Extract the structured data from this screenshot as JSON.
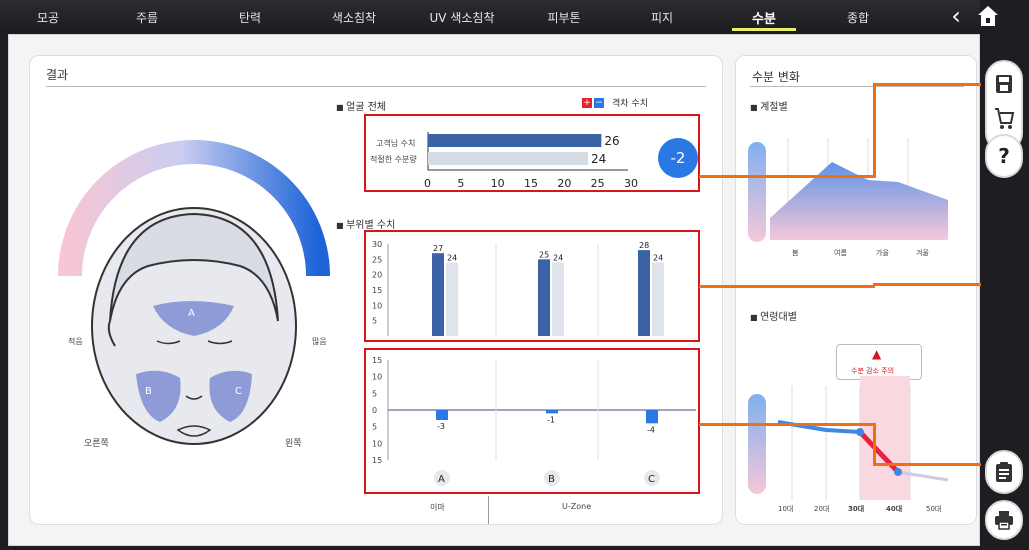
{
  "nav": {
    "tabs": [
      "모공",
      "주름",
      "탄력",
      "색소침착",
      "UV 색소침착",
      "피부톤",
      "피지",
      "수분",
      "종합"
    ],
    "active": "수분"
  },
  "result": {
    "title": "결과",
    "left_label": "적음",
    "right_label": "많음",
    "zone_a": "A",
    "zone_b": "B",
    "zone_c": "C",
    "side_right": "오른쪽",
    "side_left": "왼쪽"
  },
  "whole_face": {
    "title": "얼굴 전체",
    "legend": "격차 수치",
    "customer_label": "고객님 수치",
    "proper_label": "적절한 수분량",
    "customer_value": "26",
    "proper_value": "24",
    "gap_value": "-2",
    "axis_ticks": [
      "0",
      "5",
      "10",
      "15",
      "20",
      "25",
      "30"
    ]
  },
  "by_zone": {
    "title": "부위별 수치",
    "y_ticks": [
      "30",
      "25",
      "20",
      "15",
      "10",
      "5"
    ],
    "customer_labels": [
      "27",
      "25",
      "28"
    ],
    "proper_labels": [
      "24",
      "24",
      "24"
    ],
    "diff_ticks": [
      "15",
      "10",
      "5",
      "0",
      "5",
      "10",
      "15"
    ],
    "diff_labels": [
      "-3",
      "-1",
      "-4"
    ],
    "zones": [
      "A",
      "B",
      "C"
    ],
    "zone_group_1": "이마",
    "zone_group_2": "U-Zone"
  },
  "moisture_change": {
    "title": "수분 변화",
    "season_title": "계절별",
    "seasons": [
      "봄",
      "여름",
      "가을",
      "겨울"
    ],
    "age_title": "연령대별",
    "warning": "수분 감소 주의",
    "ages": [
      "10대",
      "20대",
      "30대",
      "40대",
      "50대"
    ]
  },
  "chart_data": [
    {
      "type": "bar",
      "categories": [
        "고객님 수치",
        "적절한 수분량"
      ],
      "values": [
        26,
        24
      ],
      "xlim": [
        0,
        30
      ]
    },
    {
      "type": "bar",
      "categories": [
        "A",
        "B",
        "C"
      ],
      "series": [
        {
          "values": [
            27,
            25,
            28
          ]
        },
        {
          "values": [
            24,
            24,
            24
          ]
        }
      ],
      "ylim": [
        0,
        30
      ]
    },
    {
      "type": "bar",
      "categories": [
        "A",
        "B",
        "C"
      ],
      "values": [
        -3,
        -1,
        -4
      ],
      "ylim": [
        -15,
        15
      ]
    }
  ],
  "colors": {
    "customer_bar": "#3a62a4",
    "gap_circle": "#2a78e4",
    "highlight_box": "#d6161d",
    "callout_line": "#ef6f12",
    "diff_bar": "#2a78e4"
  }
}
